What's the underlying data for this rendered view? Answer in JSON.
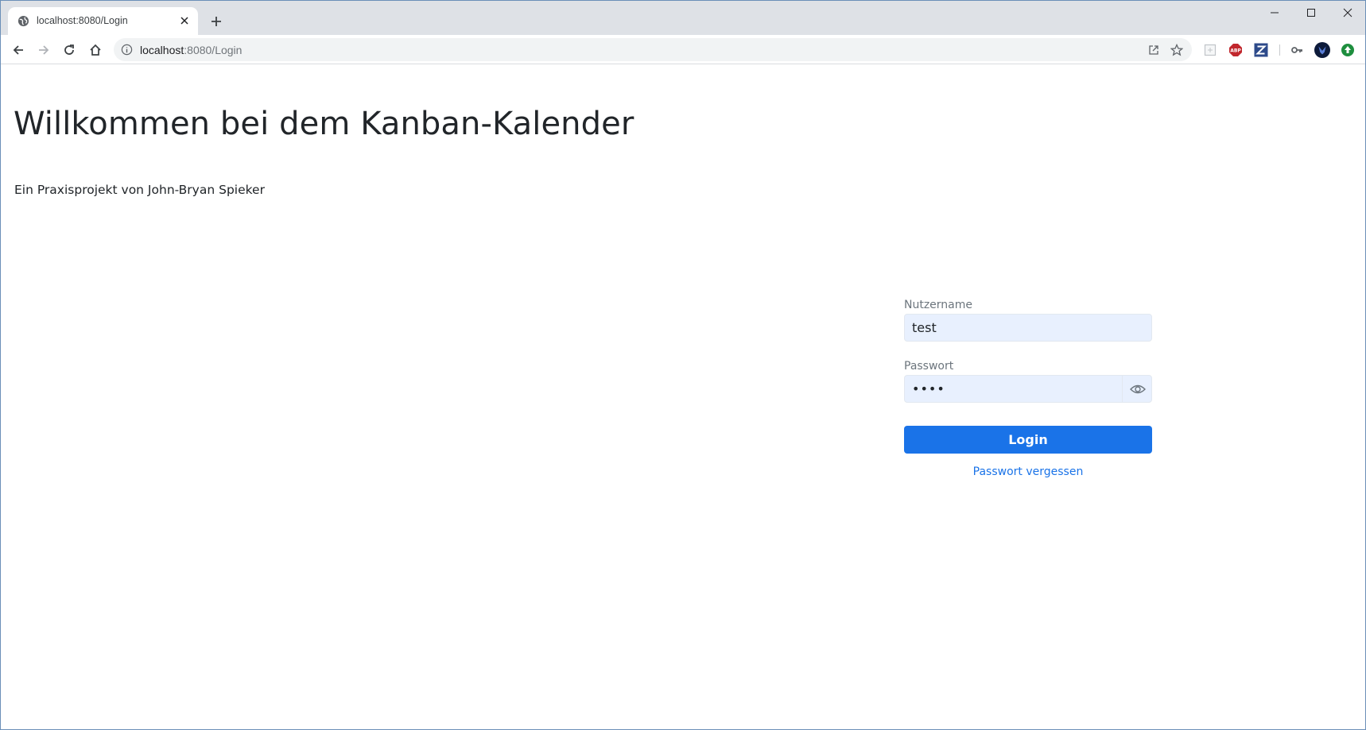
{
  "browser": {
    "tab": {
      "title": "localhost:8080/Login",
      "favicon": "globe-icon"
    },
    "address_bar": {
      "host": "localhost",
      "port_path": ":8080/Login"
    },
    "extensions": [
      "extension-placeholder-icon",
      "adblock-icon",
      "zotero-icon",
      "key-icon",
      "profile-avatar-icon",
      "update-icon"
    ]
  },
  "page": {
    "heading": "Willkommen bei dem Kanban-Kalender",
    "subtitle": "Ein Praxisprojekt von John-Bryan Spieker"
  },
  "login": {
    "username_label": "Nutzername",
    "username_value": "test",
    "password_label": "Passwort",
    "password_value": "test",
    "submit_label": "Login",
    "forgot_label": "Passwort vergessen"
  },
  "colors": {
    "primary": "#1a73e8",
    "input_autofill_bg": "#e8f0fe",
    "heading_text": "#212529",
    "label_text": "#6c757d"
  }
}
